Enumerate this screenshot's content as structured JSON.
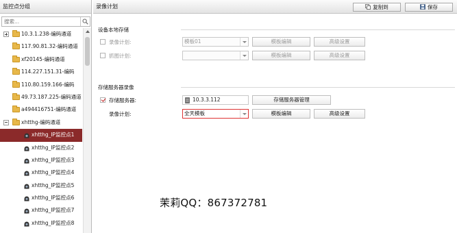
{
  "left_panel": {
    "title": "监控点分组",
    "search_placeholder": "搜索...",
    "tree": [
      {
        "label": "10.3.1.238-编码通道",
        "type": "group",
        "toggle": "plus"
      },
      {
        "label": "117.90.81.32-编码通道",
        "type": "folder"
      },
      {
        "label": "xf20145-编码通道",
        "type": "folder"
      },
      {
        "label": "114.227.151.31-编码",
        "type": "folder"
      },
      {
        "label": "110.80.159.166-编码",
        "type": "folder"
      },
      {
        "label": "49.73.187.225-编码通道",
        "type": "folder"
      },
      {
        "label": "a494416751-编码通道",
        "type": "folder"
      },
      {
        "label": "xhtthg-编码通道",
        "type": "group",
        "toggle": "minus"
      },
      {
        "label": "xhtthg_IP监控点1",
        "type": "camera",
        "selected": true
      },
      {
        "label": "xhtthg_IP监控点2",
        "type": "camera"
      },
      {
        "label": "xhtthg_IP监控点3",
        "type": "camera"
      },
      {
        "label": "xhtthg_IP监控点4",
        "type": "camera"
      },
      {
        "label": "xhtthg_IP监控点5",
        "type": "camera"
      },
      {
        "label": "xhtthg_IP监控点6",
        "type": "camera"
      },
      {
        "label": "xhtthg_IP监控点7",
        "type": "camera"
      },
      {
        "label": "xhtthg_IP监控点8",
        "type": "camera"
      }
    ]
  },
  "right_panel": {
    "title": "录像计划",
    "copy_to_label": "复制到",
    "save_label": "保存",
    "local_storage": {
      "section_title": "设备本地存储",
      "record_plan": {
        "label": "录像计划:",
        "checked": false,
        "template": "模板01",
        "edit_label": "模板编辑",
        "advanced_label": "高级设置"
      },
      "capture_plan": {
        "label": "抓图计划:",
        "checked": false,
        "template": "",
        "edit_label": "模板编辑",
        "advanced_label": "高级设置"
      }
    },
    "server_storage": {
      "section_title": "存储服务器录像",
      "storage_server": {
        "label": "存储服务器:",
        "checked": true,
        "value": "10.3.3.112",
        "manage_label": "存储服务器管理"
      },
      "record_plan": {
        "label": "录像计划:",
        "template": "全天模板",
        "edit_label": "模板编辑",
        "advanced_label": "高级设置"
      }
    }
  },
  "watermark": "茉莉QQ：867372781"
}
